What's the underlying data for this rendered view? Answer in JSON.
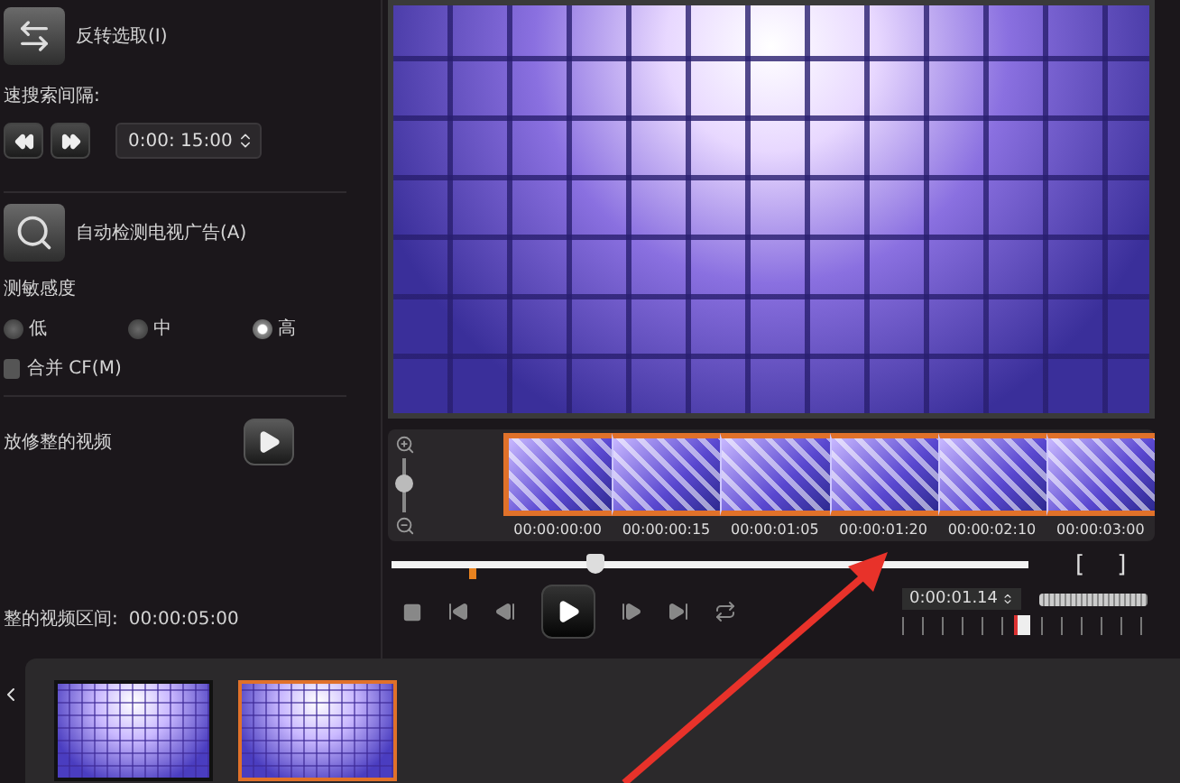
{
  "left_panel": {
    "invert_selection": {
      "label": "反转选取(I)"
    },
    "scan_interval": {
      "label": "速搜索间隔:",
      "value": "0:00: 15:00"
    },
    "detect_ads": {
      "label": "自动检测电视广告(A)"
    },
    "sensitivity": {
      "label": "测敏感度",
      "options": [
        {
          "label": "低",
          "selected": false
        },
        {
          "label": "中",
          "selected": false
        },
        {
          "label": "高",
          "selected": true
        }
      ]
    },
    "merge_cf": {
      "label": "合并 CF(M)",
      "checked": false
    },
    "play_trimmed": {
      "label": "放修整的视频"
    },
    "trimmed_duration": {
      "label": "整的视频区间:",
      "value": "00:00:05:00"
    }
  },
  "timeline": {
    "zoom_slider": {
      "level": 0.55
    },
    "timecodes": [
      "00:00:00:00",
      "00:00:00:15",
      "00:00:01:05",
      "00:00:01:20",
      "00:00:02:10",
      "00:00:03:00"
    ]
  },
  "playback": {
    "level": 0.32,
    "mark_in": "[",
    "mark_out": "]",
    "timecode": "0:00:01.14"
  },
  "clips": [
    {
      "selected": false
    },
    {
      "selected": true
    }
  ]
}
